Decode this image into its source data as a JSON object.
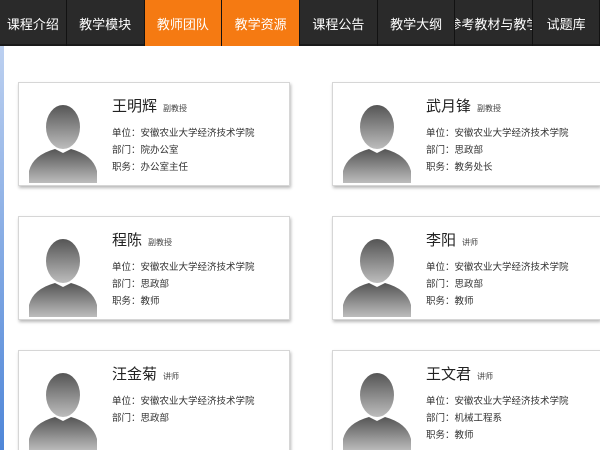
{
  "nav": {
    "items": [
      {
        "label": "课程介绍",
        "active": false
      },
      {
        "label": "教学模块",
        "active": false
      },
      {
        "label": "教师团队",
        "active": true
      },
      {
        "label": "教学资源",
        "active": true
      },
      {
        "label": "课程公告",
        "active": false
      },
      {
        "label": "教学大纲",
        "active": false
      },
      {
        "label": "参考教材与教学",
        "active": false
      },
      {
        "label": "试题库",
        "active": false
      }
    ]
  },
  "teachers": [
    {
      "name": "王明辉",
      "title": "副教授",
      "unit": "单位：安徽农业大学经济技术学院",
      "dept": "部门：院办公室",
      "post": "职务：办公室主任"
    },
    {
      "name": "武月锋",
      "title": "副教授",
      "unit": "单位：安徽农业大学经济技术学院",
      "dept": "部门：思政部",
      "post": "职务：教务处长"
    },
    {
      "name": "程陈",
      "title": "副教授",
      "unit": "单位：安徽农业大学经济技术学院",
      "dept": "部门：思政部",
      "post": "职务：教师"
    },
    {
      "name": "李阳",
      "title": "讲师",
      "unit": "单位：安徽农业大学经济技术学院",
      "dept": "部门：思政部",
      "post": "职务：教师"
    },
    {
      "name": "汪金菊",
      "title": "讲师",
      "unit": "单位：安徽农业大学经济技术学院",
      "dept": "部门：思政部",
      "post": ""
    },
    {
      "name": "王文君",
      "title": "讲师",
      "unit": "单位：安徽农业大学经济技术学院",
      "dept": "部门：机械工程系",
      "post": "职务：教师"
    }
  ],
  "colors": {
    "nav_bg": "#2a2a2a",
    "nav_active": "#f57a12"
  },
  "icons": {
    "avatar": "default-person-silhouette-icon"
  }
}
